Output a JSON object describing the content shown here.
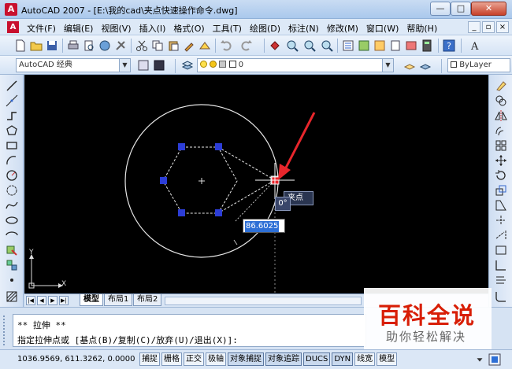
{
  "window": {
    "title": "AutoCAD 2007 - [E:\\我的cad\\夹点快速操作命令.dwg]",
    "app_icon": "autocad-logo-icon",
    "min_label": "—",
    "max_label": "□",
    "close_label": "✕"
  },
  "menu": {
    "items": [
      "文件(F)",
      "编辑(E)",
      "视图(V)",
      "插入(I)",
      "格式(O)",
      "工具(T)",
      "绘图(D)",
      "标注(N)",
      "修改(M)",
      "窗口(W)",
      "帮助(H)"
    ],
    "doc_min": "_",
    "doc_restore": "▫",
    "doc_close": "×"
  },
  "toolbar": {
    "workspace": "AutoCAD 经典",
    "layer": "0",
    "linetype": "ByLayer"
  },
  "canvas": {
    "dynamic_input_value": "86.6025",
    "angle_tooltip": "0°",
    "grip_tooltip": "夹点",
    "ucs_x": "X",
    "ucs_y": "Y",
    "annotation_color": "#e8262c",
    "grip_color": "#2c3dd6",
    "hot_grip_color": "#e8262c"
  },
  "tabs": {
    "items": [
      "模型",
      "布局1",
      "布局2"
    ],
    "active": "模型"
  },
  "command": {
    "line1": "** 拉伸 **",
    "line2": "指定拉伸点或 [基点(B)/复制(C)/放弃(U)/退出(X)]:"
  },
  "status": {
    "coords": "1036.9569, 611.3262, 0.0000",
    "buttons": [
      "捕捉",
      "栅格",
      "正交",
      "极轴",
      "对象捕捉",
      "对象追踪",
      "DUCS",
      "DYN",
      "线宽",
      "模型"
    ]
  },
  "watermark": {
    "title": "百科全说",
    "subtitle": "助你轻松解决"
  }
}
